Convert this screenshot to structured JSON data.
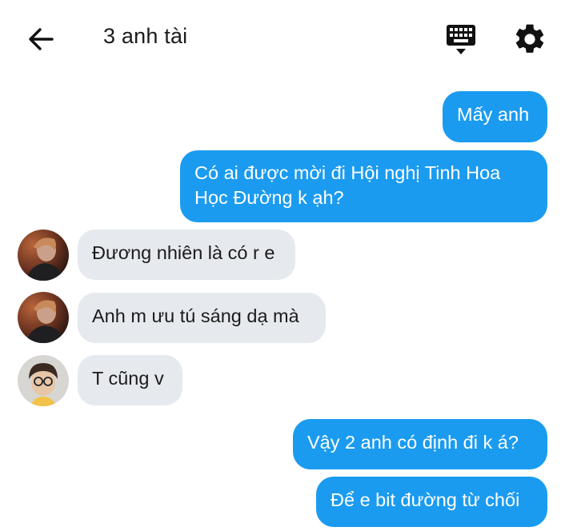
{
  "header": {
    "title": "3 anh tài",
    "back_icon": "arrow-left-icon",
    "keyboard_icon": "keyboard-icon",
    "settings_icon": "gear-icon"
  },
  "colors": {
    "outgoing_bubble": "#1a9bf0",
    "incoming_bubble": "#e6e9ee"
  },
  "messages": [
    {
      "direction": "out",
      "text": "Mấy anh"
    },
    {
      "direction": "out",
      "lines": [
        "Có ai được mời đi Hội nghị Tinh Hoa",
        "Học Đường k ạh?"
      ]
    },
    {
      "direction": "in",
      "sender_avatar": "avatar-1",
      "text": "Đương nhiên là có r e"
    },
    {
      "direction": "in",
      "sender_avatar": "avatar-1",
      "text": "Anh m ưu tú sáng dạ mà"
    },
    {
      "direction": "in",
      "sender_avatar": "avatar-2",
      "text": "T cũng v"
    },
    {
      "direction": "out",
      "text": "Vậy 2 anh có định đi k á?"
    },
    {
      "direction": "out",
      "text": "Để e bit đường từ chối"
    }
  ]
}
